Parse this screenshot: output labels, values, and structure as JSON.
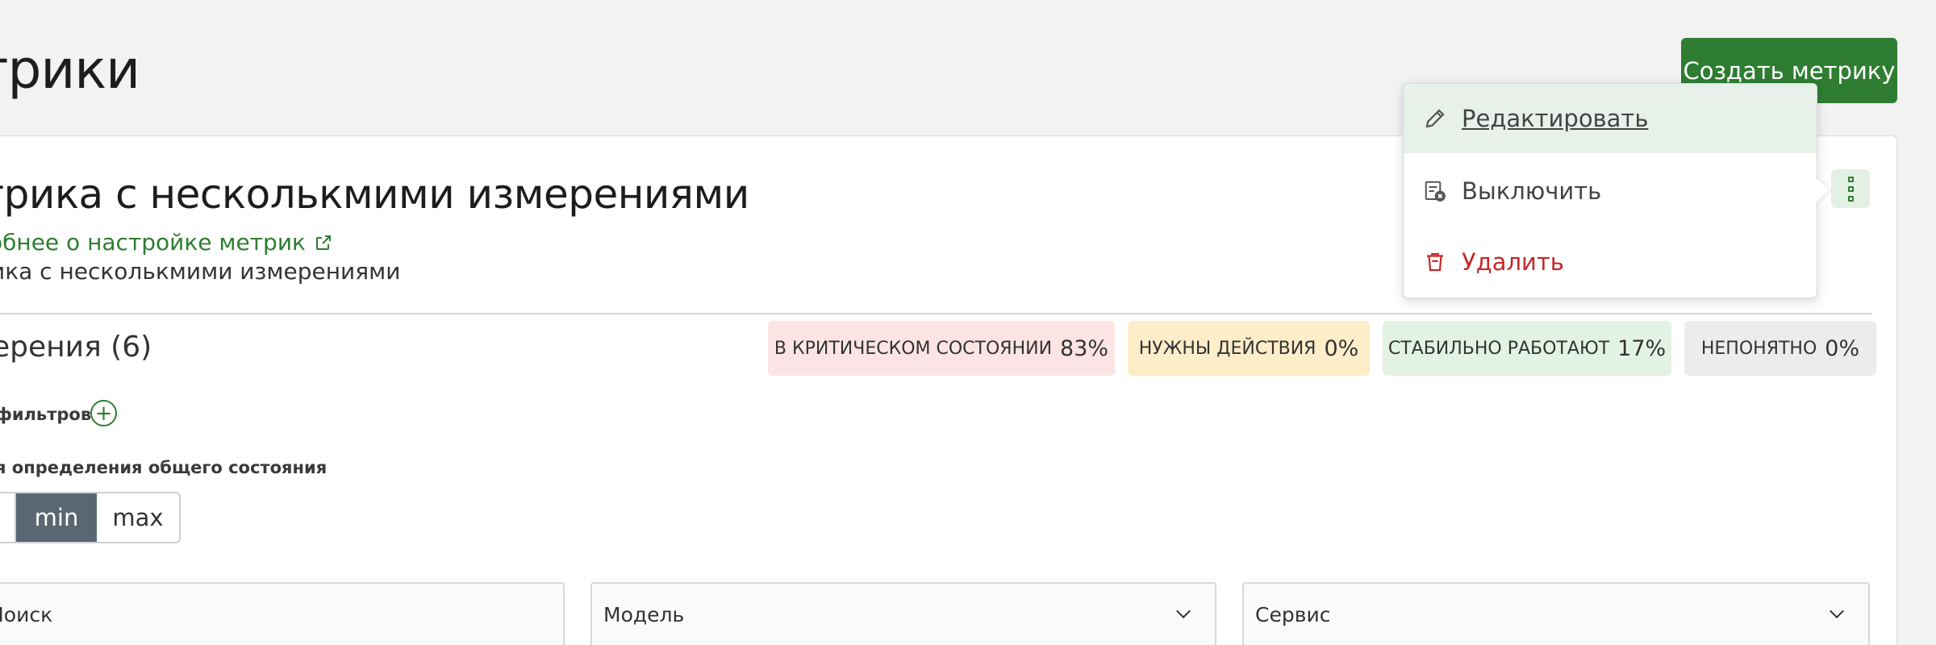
{
  "header": {
    "title": "трики",
    "create_button": "Создать метрику"
  },
  "metric": {
    "title": "трика с несколькмими измерениями",
    "docs_link": "обнее о настройке метрик",
    "description": "ика с несколькмими измерениями"
  },
  "dimensions": {
    "title": "ерения (6)",
    "filters_label": "фильтров",
    "mode_label": "я определения общего состояния",
    "mode_options": [
      "",
      "min",
      "max"
    ],
    "mode_selected": "min"
  },
  "status_badges": [
    {
      "label": "В КРИТИЧЕСКОМ СОСТОЯНИИ",
      "value": "83%",
      "color": "#fde4e4"
    },
    {
      "label": "НУЖНЫ ДЕЙСТВИЯ",
      "value": "0%",
      "color": "#fdeec9"
    },
    {
      "label": "СТАБИЛЬНО РАБОТАЮТ",
      "value": "17%",
      "color": "#e2f3e3"
    },
    {
      "label": "НЕПОНЯТНО",
      "value": "0%",
      "color": "#ececec"
    }
  ],
  "fields": {
    "search": "Поиск",
    "model": "Модель",
    "service": "Сервис"
  },
  "menu": {
    "edit": "Редактировать",
    "disable": "Выключить",
    "delete": "Удалить"
  },
  "colors": {
    "accent": "#2e7d32",
    "danger": "#c62828",
    "segment_active": "#5a6773"
  }
}
